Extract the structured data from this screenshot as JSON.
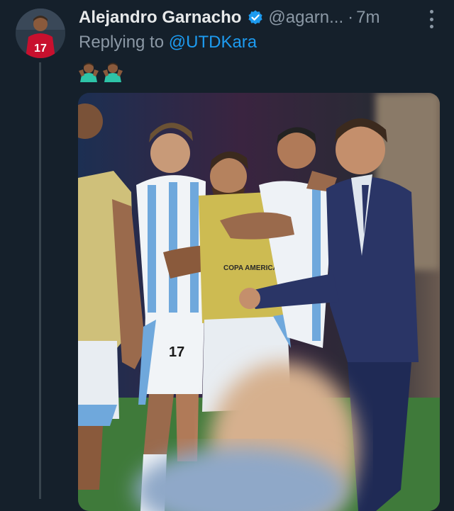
{
  "tweet": {
    "display_name": "Alejandro Garnacho",
    "handle": "@agarn...",
    "separator": "·",
    "time": "7m",
    "reply_prefix": "Replying to",
    "reply_mention": "@UTDKara",
    "avatar_number": "17",
    "emojis": [
      "man-shrugging-emoji",
      "man-shrugging-emoji"
    ],
    "photo": {
      "jersey_number": "17",
      "shirt_print": "COPA AMERICA USA 2024"
    }
  },
  "colors": {
    "background": "#15202b",
    "link": "#1d9bf0",
    "secondary_text": "#8b98a5",
    "verified_badge": "#1d9bf0"
  }
}
